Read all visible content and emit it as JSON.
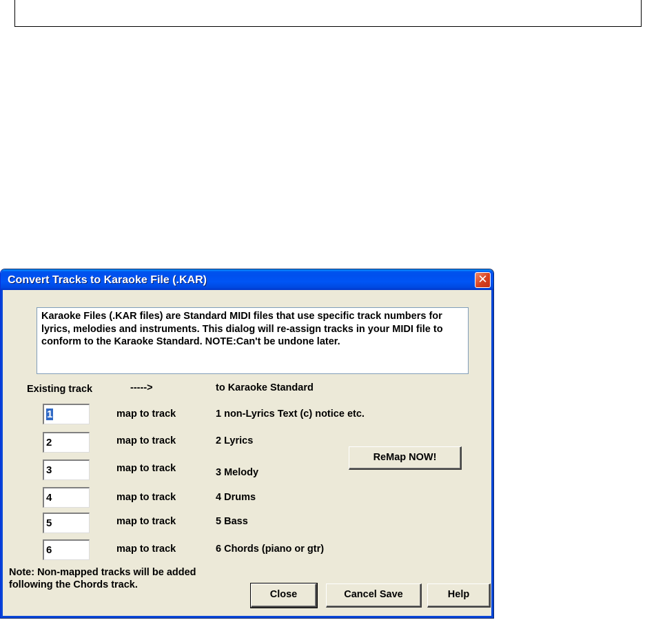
{
  "dialog": {
    "title": "Convert Tracks to Karaoke File (.KAR)",
    "close_glyph": "✕",
    "description": "Karaoke Files (.KAR files) are Standard MIDI files that use specific track numbers for lyrics, melodies and instruments. This dialog will re-assign tracks in your MIDI file to conform to the Karaoke Standard. NOTE:Can't be undone later.",
    "header": {
      "existing": "Existing track",
      "arrow": "----->",
      "standard": "to Karaoke Standard"
    },
    "rows": [
      {
        "value": "1",
        "map_label": "map to track",
        "target": "1  non-Lyrics Text (c) notice etc."
      },
      {
        "value": "2",
        "map_label": "map to track",
        "target": "2  Lyrics"
      },
      {
        "value": "3",
        "map_label": "map to track",
        "target": "3  Melody"
      },
      {
        "value": "4",
        "map_label": "map to track",
        "target": "4  Drums"
      },
      {
        "value": "5",
        "map_label": "map to track",
        "target": "5  Bass"
      },
      {
        "value": "6",
        "map_label": "map to track",
        "target": "6  Chords  (piano or gtr)"
      }
    ],
    "remap_button": "ReMap NOW!",
    "note_line1": "Note: Non-mapped tracks will be added",
    "note_line2": "following the Chords track.",
    "buttons": {
      "close": "Close",
      "cancel_save": "Cancel Save",
      "help": "Help"
    }
  }
}
